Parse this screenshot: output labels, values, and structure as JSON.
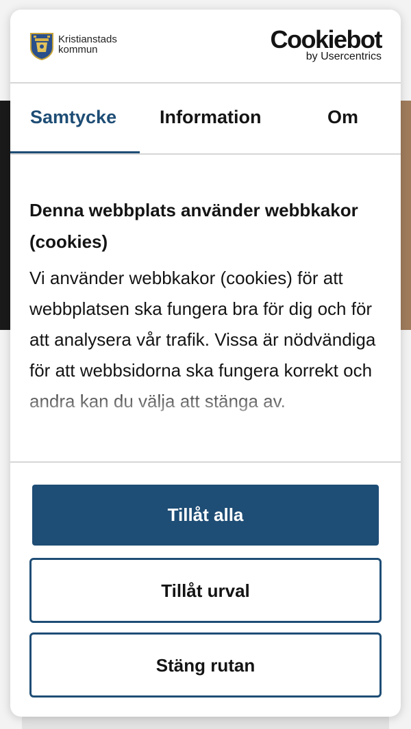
{
  "brand": {
    "logo_icon": "crest-icon",
    "name_line1": "Kristianstads",
    "name_line2": "kommun"
  },
  "cookiebot": {
    "logo_text": "Cookiebot",
    "subtitle": "by Usercentrics"
  },
  "tabs": [
    {
      "label": "Samtycke",
      "active": true
    },
    {
      "label": "Information",
      "active": false
    },
    {
      "label": "Om",
      "active": false
    }
  ],
  "content": {
    "heading": "Denna webbplats använder webbkakor (cookies)",
    "body": "Vi använder webbkakor (cookies) för att webbplatsen ska fungera bra för dig och för att analysera vår trafik. Vissa är nödvändiga för att webbsidorna ska fungera korrekt och andra kan du välja att stänga av."
  },
  "buttons": {
    "allow_all": "Tillåt alla",
    "allow_selection": "Tillåt urval",
    "close": "Stäng rutan"
  },
  "colors": {
    "accent": "#1e4d75",
    "text": "#141414",
    "divider": "#d6d6d6"
  }
}
